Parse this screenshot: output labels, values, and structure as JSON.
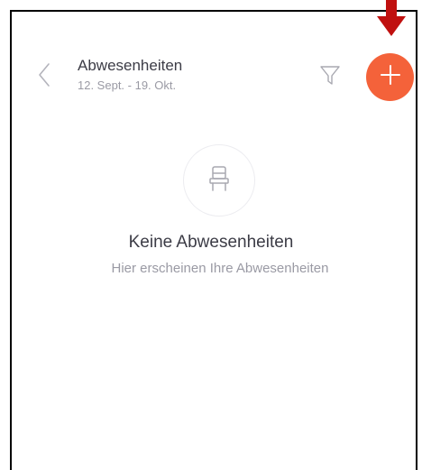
{
  "header": {
    "title": "Abwesenheiten",
    "date_range": "12. Sept. - 19. Okt."
  },
  "icons": {
    "back": "chevron-left-icon",
    "filter": "filter-icon",
    "add": "plus-icon",
    "empty_state": "chair-icon",
    "annotation": "arrow-down-icon"
  },
  "empty_state": {
    "title": "Keine Abwesenheiten",
    "subtitle": "Hier erscheinen Ihre Abwesenheiten"
  },
  "colors": {
    "accent": "#f4623a",
    "annotation_arrow": "#c0100f",
    "text_primary": "#3c3c46",
    "text_secondary": "#9a9aa4"
  }
}
